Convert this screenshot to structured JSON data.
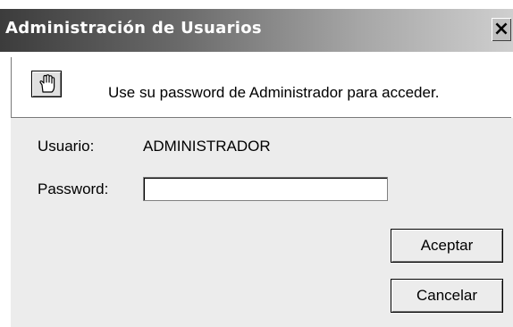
{
  "window": {
    "title": "Administración de Usuarios",
    "close_glyph": "×",
    "titlebar_colors": [
      "#3c3c3c",
      "#cfcfcf"
    ]
  },
  "info": {
    "icon": "hand-icon",
    "message": "Use su password de Administrador para acceder."
  },
  "form": {
    "user_label": "Usuario:",
    "user_value": "ADMINISTRADOR",
    "password_label": "Password:",
    "password_value": ""
  },
  "buttons": {
    "accept_label": "Aceptar",
    "cancel_label": "Cancelar"
  }
}
